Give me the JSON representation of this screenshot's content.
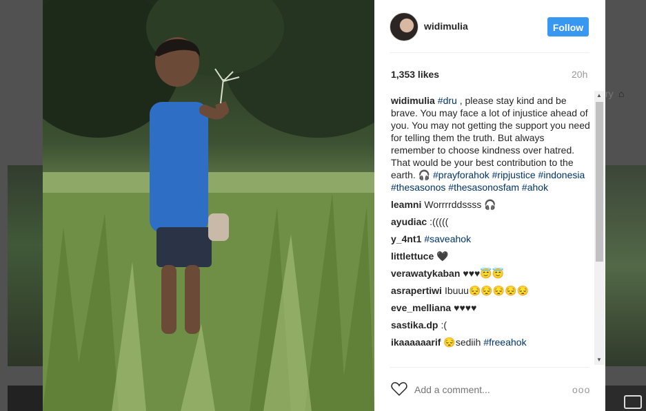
{
  "author": {
    "username": "widimulia",
    "follow_label": "Follow"
  },
  "post": {
    "likes": "1,353 likes",
    "time": "20h"
  },
  "caption": {
    "username": "widimulia",
    "parts": [
      {
        "text": "#dru",
        "tag": true
      },
      {
        "text": " , please stay kind and be brave. You may face a lot of injustice ahead of you. You may not getting the support you need for telling them the truth. But always remember to choose kindness over hatred. That would be your best contribution to the earth. 🎧 ",
        "tag": false
      },
      {
        "text": "#prayforahok",
        "tag": true
      },
      {
        "text": " ",
        "tag": false
      },
      {
        "text": "#ripjustice",
        "tag": true
      },
      {
        "text": " ",
        "tag": false
      },
      {
        "text": "#indonesia",
        "tag": true
      },
      {
        "text": " ",
        "tag": false
      },
      {
        "text": "#thesasonos",
        "tag": true
      },
      {
        "text": " ",
        "tag": false
      },
      {
        "text": "#thesasonosfam",
        "tag": true
      },
      {
        "text": " ",
        "tag": false
      },
      {
        "text": "#ahok",
        "tag": true
      }
    ]
  },
  "comments": [
    {
      "user": "leamni",
      "parts": [
        {
          "text": "Worrrrddssss 🎧",
          "tag": false
        }
      ]
    },
    {
      "user": "ayudiac",
      "parts": [
        {
          "text": ":(((((",
          "tag": false
        }
      ]
    },
    {
      "user": "y_4nt1",
      "parts": [
        {
          "text": "#saveahok",
          "tag": true
        }
      ]
    },
    {
      "user": "littlettuce",
      "parts": [
        {
          "text": "🖤",
          "tag": false
        }
      ]
    },
    {
      "user": "verawatykaban",
      "parts": [
        {
          "text": "♥♥♥😇😇",
          "tag": false
        }
      ]
    },
    {
      "user": "asrapertiwi",
      "parts": [
        {
          "text": "Ibuuu😔😔😔😔😔",
          "tag": false
        }
      ]
    },
    {
      "user": "eve_melliana",
      "parts": [
        {
          "text": "♥♥♥♥",
          "tag": false
        }
      ]
    },
    {
      "user": "sastika.dp",
      "parts": [
        {
          "text": ":(",
          "tag": false
        }
      ]
    },
    {
      "user": "ikaaaaaarif",
      "parts": [
        {
          "text": "😔sediih ",
          "tag": false
        },
        {
          "text": "#freeahok",
          "tag": true
        }
      ]
    }
  ],
  "comment_input": {
    "placeholder": "Add a comment..."
  },
  "more_label": "ooo",
  "background": {
    "right_text": "ry"
  },
  "colors": {
    "follow": "#3897f0",
    "hashtag": "#003569",
    "text": "#262626",
    "muted": "#999999"
  }
}
